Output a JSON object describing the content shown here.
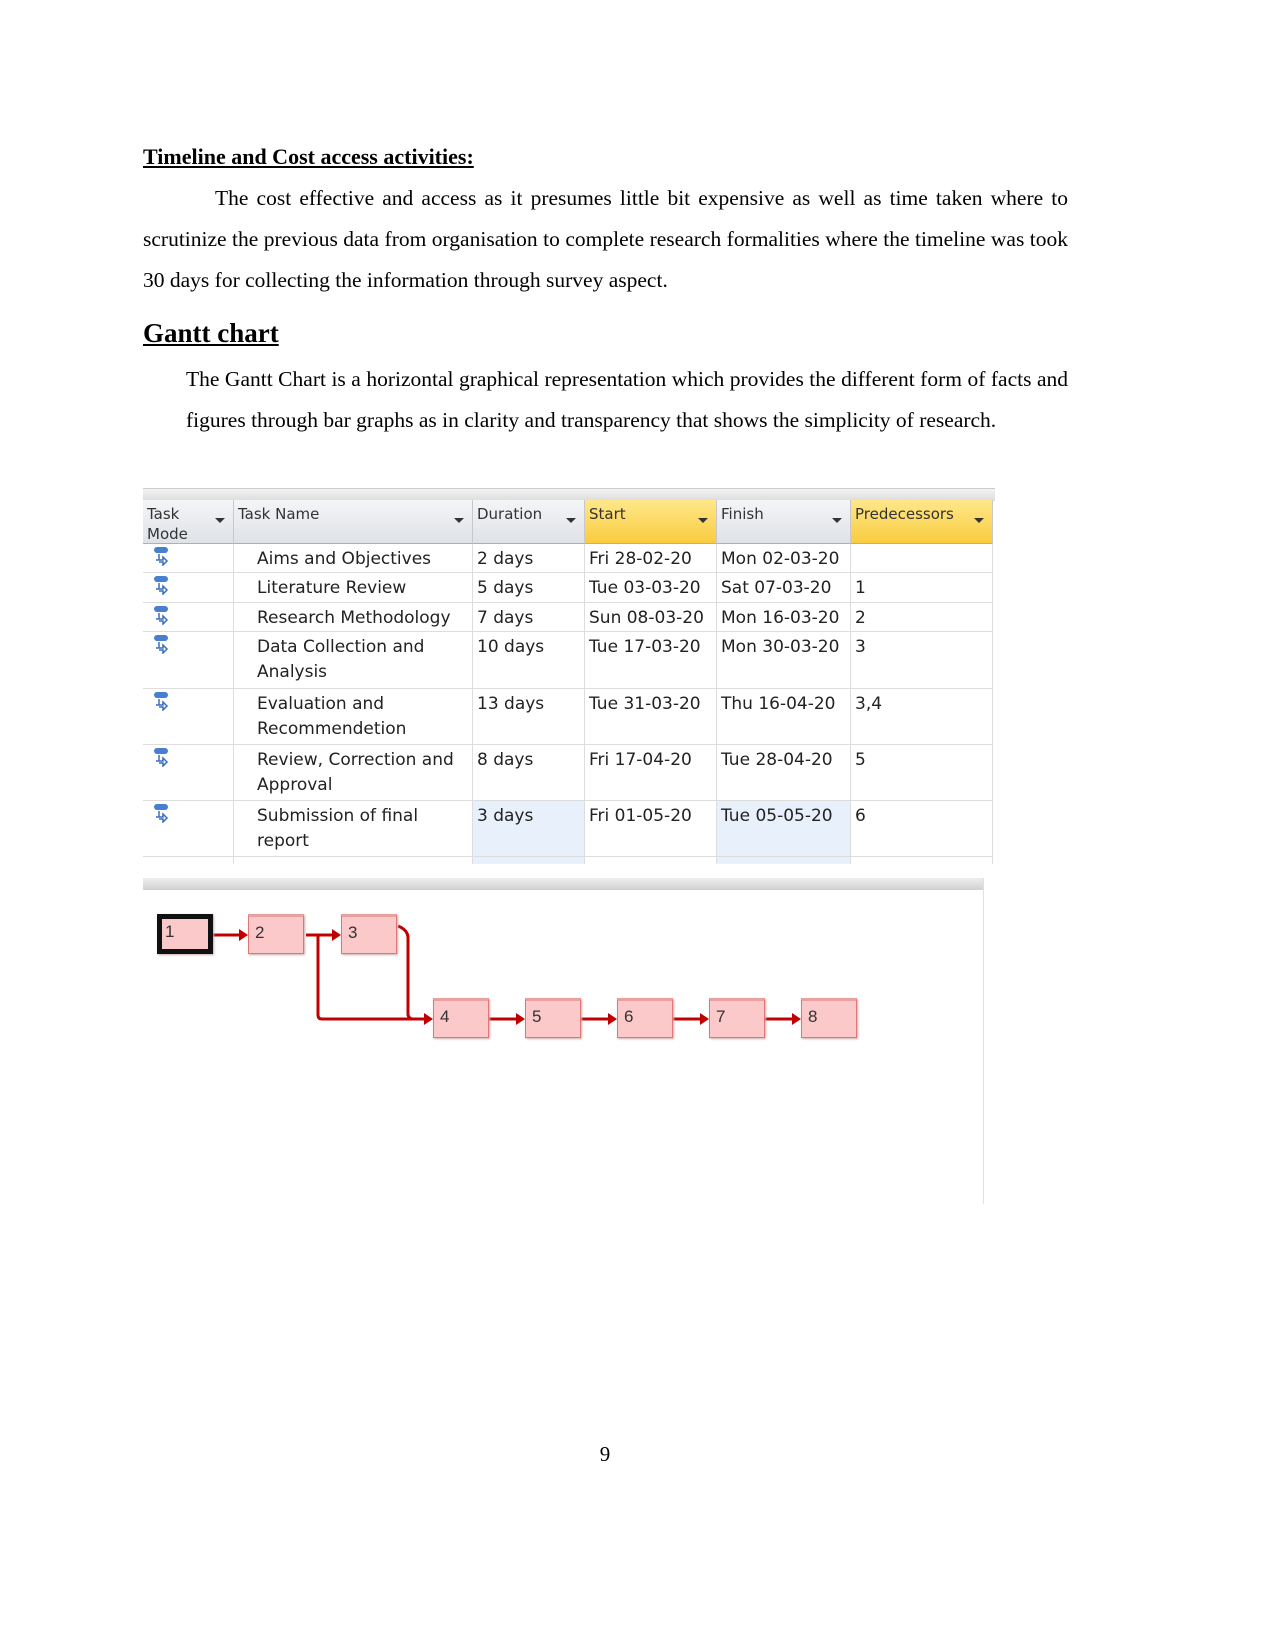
{
  "section_heading": "Timeline and Cost access activities:",
  "section_paragraph": "The cost effective  and access as it presumes little bit expensive as well as time taken where to scrutinize the previous data from organisation to complete research formalities where the timeline was took 30 days for collecting the information through survey aspect.",
  "gantt_heading": "Gantt chart ",
  "gantt_paragraph": "The Gantt Chart is a horizontal graphical representation which provides the different form of facts and figures through bar graphs as in clarity and transparency that shows the simplicity of research.",
  "table": {
    "columns": [
      "Task Mode",
      "Task Name",
      "Duration",
      "Start",
      "Finish",
      "Predecessors"
    ],
    "rows": [
      {
        "name": "Aims and Objectives",
        "duration": "2 days",
        "start": "Fri 28-02-20",
        "finish": "Mon 02-03-20",
        "pred": ""
      },
      {
        "name": "Literature Review",
        "duration": "5 days",
        "start": "Tue 03-03-20",
        "finish": "Sat 07-03-20",
        "pred": "1"
      },
      {
        "name": "Research Methodology",
        "duration": "7 days",
        "start": "Sun 08-03-20",
        "finish": "Mon 16-03-20",
        "pred": "2"
      },
      {
        "name": "Data Collection and Analysis",
        "duration": "10 days",
        "start": "Tue 17-03-20",
        "finish": "Mon 30-03-20",
        "pred": "3"
      },
      {
        "name": "Evaluation and Recommendetion",
        "duration": "13 days",
        "start": "Tue 31-03-20",
        "finish": "Thu 16-04-20",
        "pred": "3,4"
      },
      {
        "name": "Review, Correction and Approval",
        "duration": "8 days",
        "start": "Fri 17-04-20",
        "finish": "Tue 28-04-20",
        "pred": "5"
      },
      {
        "name": "Submission of final report",
        "duration": "3 days",
        "start": "Fri 01-05-20",
        "finish": "Tue 05-05-20",
        "pred": "6"
      }
    ],
    "highlight_color": "#f9cc3f"
  },
  "network": {
    "nodes": [
      "1",
      "2",
      "3",
      "4",
      "5",
      "6",
      "7",
      "8"
    ],
    "link_color": "#c00000",
    "node_color": "#fbc9c9"
  },
  "page_number": "9"
}
